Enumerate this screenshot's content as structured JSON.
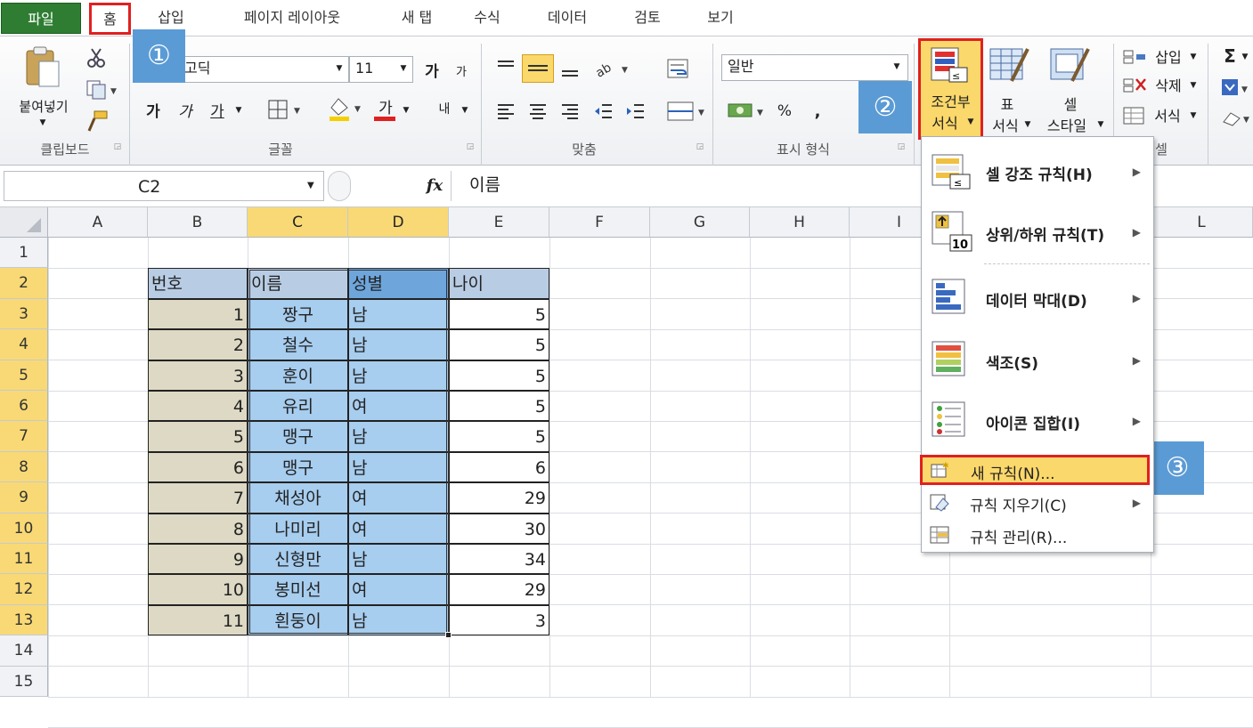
{
  "tabs": {
    "file": "파일",
    "home": "홈",
    "insert": "삽입",
    "page_layout": "페이지 레이아웃",
    "new_tab": "새 탭",
    "formulas": "수식",
    "data": "데이터",
    "review": "검토",
    "view": "보기"
  },
  "ribbon": {
    "paste": "붙여넣기",
    "clipboard": "클립보드",
    "font_name": "고딕",
    "font_size": "11",
    "font_group": "글꼴",
    "align_group": "맞춤",
    "number_format": "일반",
    "number_group": "표시 형식",
    "percent": "%",
    "comma": ",",
    "cond_format_line1": "조건부",
    "cond_format_line2": "서식",
    "table_line1": "표",
    "table_line2": "서식",
    "cell_style_line1": "셀",
    "cell_style_line2": "스타일",
    "insert": "삽입",
    "delete": "삭제",
    "format": "서식",
    "cells_group": "셀",
    "bold": "가",
    "italic": "가",
    "underline": "가",
    "font_color": "가",
    "grow": "가",
    "shrink": "가",
    "wrap": "내",
    "sum": "Σ"
  },
  "badges": {
    "one": "①",
    "two": "②",
    "three": "③"
  },
  "formula_bar": {
    "name_box": "C2",
    "fx": "fx",
    "value": "이름"
  },
  "columns": [
    "A",
    "B",
    "C",
    "D",
    "E",
    "F",
    "G",
    "H",
    "I",
    "L"
  ],
  "rows": [
    "1",
    "2",
    "3",
    "4",
    "5",
    "6",
    "7",
    "8",
    "9",
    "10",
    "11",
    "12",
    "13",
    "14",
    "15"
  ],
  "table": {
    "headers": [
      "번호",
      "이름",
      "성별",
      "나이"
    ],
    "rows": [
      [
        "1",
        "짱구",
        "남",
        "5"
      ],
      [
        "2",
        "철수",
        "남",
        "5"
      ],
      [
        "3",
        "훈이",
        "남",
        "5"
      ],
      [
        "4",
        "유리",
        "여",
        "5"
      ],
      [
        "5",
        "맹구",
        "남",
        "5"
      ],
      [
        "6",
        "맹구",
        "남",
        "6"
      ],
      [
        "7",
        "채성아",
        "여",
        "29"
      ],
      [
        "8",
        "나미리",
        "여",
        "30"
      ],
      [
        "9",
        "신형만",
        "남",
        "34"
      ],
      [
        "10",
        "봉미선",
        "여",
        "29"
      ],
      [
        "11",
        "흰둥이",
        "남",
        "3"
      ]
    ]
  },
  "menu": {
    "highlight_rules": "셀 강조 규칙(H)",
    "top_bottom": "상위/하위 규칙(T)",
    "data_bars": "데이터 막대(D)",
    "color_scales": "색조(S)",
    "icon_sets": "아이콘 집합(I)",
    "new_rule": "새 규칙(N)...",
    "clear_rules": "규칙 지우기(C)",
    "manage_rules": "규칙 관리(R)..."
  },
  "colors": {
    "accent_red": "#e02020",
    "badge_blue": "#5b9bd5",
    "selection_blue": "#a7cdef",
    "header_fill": "#b8cde4",
    "number_fill": "#ddd9c4",
    "hover_yellow": "#fbd86b"
  }
}
